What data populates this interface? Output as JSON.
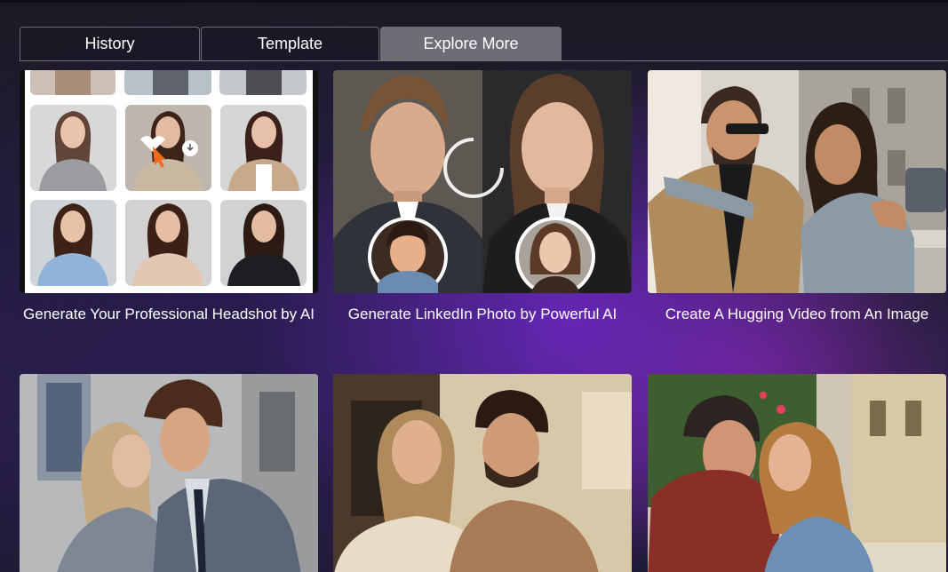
{
  "tabs": [
    {
      "label": "History",
      "active": false
    },
    {
      "label": "Template",
      "active": false
    },
    {
      "label": "Explore More",
      "active": true
    }
  ],
  "colors": {
    "active_tab": "#6f6c76",
    "tab_border": "#6b6a78",
    "accent_purple": "#6a28c8",
    "text": "#ffffff"
  },
  "cards": [
    {
      "title": "Generate Your Professional Headshot by AI",
      "image": "headshot-grid-image"
    },
    {
      "title": "Generate LinkedIn Photo by Powerful AI",
      "image": "linkedin-photo-image"
    },
    {
      "title": "Create A Hugging Video from An Image",
      "image": "hugging-couple-image"
    },
    {
      "title": "",
      "image": "kissing-couple-street-image"
    },
    {
      "title": "",
      "image": "smiling-couple-indoor-image"
    },
    {
      "title": "",
      "image": "kissing-couple-garden-image"
    }
  ]
}
